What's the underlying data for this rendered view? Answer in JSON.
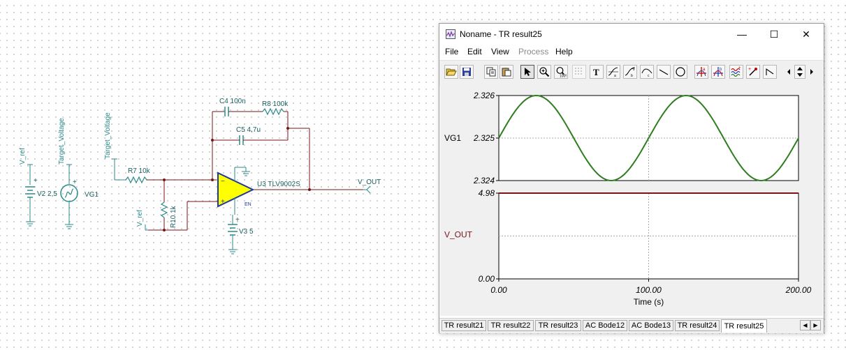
{
  "schematic": {
    "labels": {
      "v_ref_left": "V_ref",
      "target_voltage_left": "Target_Voltage",
      "target_voltage_mid": "Target_Voltage",
      "v_ref_mid": "V_ref",
      "v2": "V2 2,5",
      "vg1": "VG1",
      "r7": "R7 10k",
      "r10": "R10 1k",
      "c4": "C4 100n",
      "r8": "R8 100k",
      "c5": "C5 4,7u",
      "u3": "U3 TLV9002S",
      "en": "EN",
      "v3": "V3 5",
      "v_out": "V_OUT",
      "plus_v2": "+",
      "plus_vg1": "+",
      "plus_v3": "+"
    }
  },
  "window": {
    "title": "Noname - TR result25",
    "minimize": "—",
    "maximize": "☐",
    "close": "✕",
    "menu": [
      "File",
      "Edit",
      "View",
      "Process",
      "Help"
    ],
    "toolbar": [
      {
        "icon": "open-folder-icon"
      },
      {
        "icon": "save-icon"
      },
      {
        "icon": "copy-icon"
      },
      {
        "icon": "paste-icon"
      },
      {
        "icon": "pointer-icon"
      },
      {
        "icon": "zoom-in-icon"
      },
      {
        "icon": "zoom-100-icon"
      },
      {
        "icon": "grid-icon"
      },
      {
        "icon": "text-icon"
      },
      {
        "icon": "curve-a-icon"
      },
      {
        "icon": "curve-b-icon"
      },
      {
        "icon": "curve-c-icon"
      },
      {
        "icon": "line-icon"
      },
      {
        "icon": "circle-icon"
      },
      {
        "icon": "cursor-a-icon"
      },
      {
        "icon": "cursor-b-icon"
      },
      {
        "icon": "waveform-icon"
      },
      {
        "icon": "probe-icon"
      },
      {
        "icon": "ramp-icon"
      }
    ],
    "tabs": [
      {
        "label": "TR result21"
      },
      {
        "label": "TR result22"
      },
      {
        "label": "TR result23"
      },
      {
        "label": "AC Bode12"
      },
      {
        "label": "AC Bode13"
      },
      {
        "label": "TR result24"
      },
      {
        "label": "TR result25",
        "active": true
      }
    ],
    "tab_scroll_left": "◀",
    "tab_scroll_right": "▶"
  },
  "chart_data": [
    {
      "type": "line",
      "ylabel": "VG1",
      "series_color": "#2e7d1f",
      "ylim": [
        2.324,
        2.326
      ],
      "yticks": [
        "2.326",
        "2.325",
        "2.324"
      ],
      "x": [
        0,
        100,
        200
      ],
      "series": [
        {
          "name": "VG1",
          "waveform": "sine",
          "offset": 2.325,
          "amplitude": 0.001,
          "period_s": 100,
          "start_value": 2.325,
          "start_direction": "rising"
        }
      ]
    },
    {
      "type": "line",
      "ylabel": "V_OUT",
      "series_color": "#7b1515",
      "ylim": [
        0,
        4.98
      ],
      "yticks": [
        "4.98",
        "0.00"
      ],
      "xticks": [
        "0.00",
        "100.00",
        "200.00"
      ],
      "xlabel": "Time (s)",
      "xlim": [
        0,
        200
      ],
      "series": [
        {
          "name": "V_OUT",
          "x": [
            0,
            200
          ],
          "y": [
            4.98,
            4.98
          ]
        }
      ]
    }
  ],
  "colors": {
    "wire": "#7a1414",
    "component": "#2a8a8a",
    "opamp_fill": "#ffff00",
    "grid": "#aaaaaa"
  }
}
